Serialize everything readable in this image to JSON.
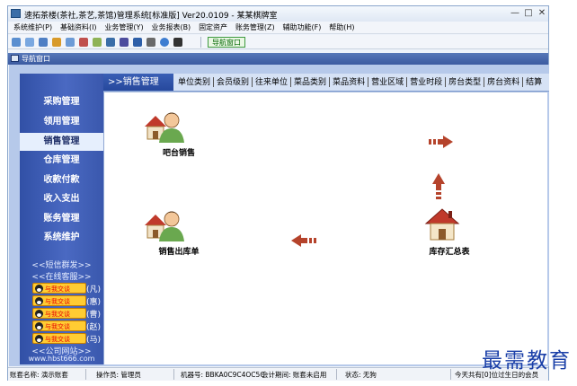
{
  "window": {
    "title": "速拓茶楼(茶社,茶艺,茶馆)管理系统[标准版] Ver20.0109 - 某某棋牌室",
    "controls": {
      "minimize": "—",
      "restore": "□",
      "close": "✕"
    }
  },
  "menu": [
    "系统维护(P)",
    "基础资料(I)",
    "业务管理(Y)",
    "业务报表(B)",
    "固定资产",
    "账务管理(Z)",
    "辅助功能(F)",
    "帮助(H)"
  ],
  "toolbar": {
    "nav_button_label": "导航窗口",
    "icons": [
      "new-icon",
      "list-icon",
      "grid-icon",
      "edit-icon",
      "copy-icon",
      "transfer-icon",
      "refresh-icon",
      "user-icon",
      "print-icon",
      "save-icon",
      "export-icon",
      "help-icon",
      "exit-icon"
    ]
  },
  "subwindow": {
    "title": "导航窗口"
  },
  "sidebar": {
    "items": [
      "采购管理",
      "领用管理",
      "销售管理",
      "仓库管理",
      "收款付款",
      "收入支出",
      "账务管理",
      "系统维护"
    ],
    "active": "销售管理",
    "links": [
      "<<短信群发>>",
      "<<在线客服>>"
    ],
    "qq_label": "与我交谈",
    "qq_names": [
      "(凡)",
      "(惠)",
      "(曹)",
      "(赵)",
      "(马)"
    ],
    "site_label": "<<公司网站>>",
    "site_url": "www.hbst666.com"
  },
  "tabs": {
    "active_label": ">>销售管理",
    "items": [
      "单位类别",
      "会员级别",
      "往来单位",
      "菜品类别",
      "菜品资料",
      "营业区域",
      "营业时段",
      "房台类型",
      "房台资料",
      "结算"
    ]
  },
  "flow": {
    "nodes": [
      "吧台销售",
      "销售出库单",
      "库存汇总表"
    ]
  },
  "status": {
    "account": "账套名称: 演示账套",
    "operator": "操作员: 管理员",
    "machine": "机器号: BBKA0C9C4OC5C",
    "period": "会计期间: 账套未启用",
    "state": "状态: 无狗",
    "message": "今天共有[0]位过生日的会员"
  },
  "watermark": "最需教育",
  "colors": {
    "sidebar": "#3f5fb5",
    "active_tab": "#2f52a8",
    "canvas": "#ffffff",
    "arrow": "#b5432b",
    "nav_button": "#3e9a3e"
  }
}
